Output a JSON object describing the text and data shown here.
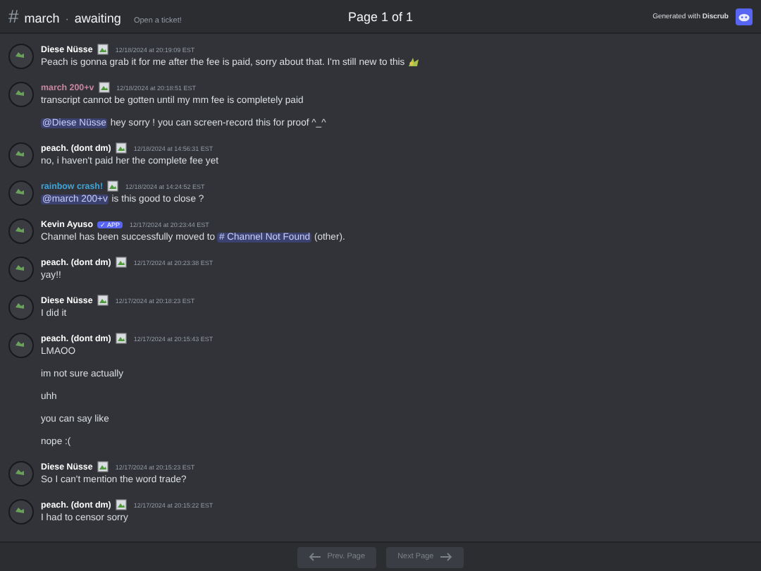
{
  "header": {
    "hash": "#",
    "channel": "march",
    "separator": "·",
    "subchannel": "awaiting",
    "topic": "Open a ticket!",
    "page": "Page 1 of 1",
    "generated_prefix": "Generated with",
    "generated_brand": "Discrub"
  },
  "messages": [
    {
      "author": "Diese Nüsse",
      "color": "#ffffff",
      "kind": "image",
      "timestamp": "12/18/2024 at 20:19:09 EST",
      "lines": [
        [
          {
            "kind": "text",
            "text": "Peach is gonna grab it for me after the fee is paid, sorry about that. I'm still new to this"
          },
          {
            "kind": "emoji"
          }
        ]
      ]
    },
    {
      "author": "march 200+v",
      "color": "#c9869f",
      "kind": "image",
      "timestamp": "12/18/2024 at 20:18:51 EST",
      "lines": [
        [
          {
            "kind": "text",
            "text": "transcript cannot be gotten until my mm fee is completely paid"
          }
        ],
        [
          {
            "kind": "mention",
            "text": "@Diese Nüsse"
          },
          {
            "kind": "text",
            "text": " hey sorry ! you can screen-record this for proof ^_^"
          }
        ]
      ]
    },
    {
      "author": "peach. (dont dm)",
      "color": "#ffffff",
      "kind": "image",
      "timestamp": "12/18/2024 at 14:56:31 EST",
      "lines": [
        [
          {
            "kind": "text",
            "text": "no, i haven't paid her the complete fee yet"
          }
        ]
      ]
    },
    {
      "author": "rainbow crash!",
      "color": "#3fa5d8",
      "kind": "image",
      "timestamp": "12/18/2024 at 14:24:52 EST",
      "lines": [
        [
          {
            "kind": "mention",
            "text": "@march 200+v"
          },
          {
            "kind": "text",
            "text": " is this good to close ?"
          }
        ]
      ]
    },
    {
      "author": "Kevin Ayuso",
      "color": "#ffffff",
      "kind": "app",
      "badge_text": "✓ APP",
      "timestamp": "12/17/2024 at 20:23:44 EST",
      "lines": [
        [
          {
            "kind": "text",
            "text": "Channel has been successfully moved to "
          },
          {
            "kind": "mention",
            "text": "# Channel Not Found"
          },
          {
            "kind": "text",
            "text": " (other)."
          }
        ]
      ]
    },
    {
      "author": "peach. (dont dm)",
      "color": "#ffffff",
      "kind": "image",
      "timestamp": "12/17/2024 at 20:23:38 EST",
      "lines": [
        [
          {
            "kind": "text",
            "text": "yay!!"
          }
        ]
      ]
    },
    {
      "author": "Diese Nüsse",
      "color": "#ffffff",
      "kind": "image",
      "timestamp": "12/17/2024 at 20:18:23 EST",
      "lines": [
        [
          {
            "kind": "text",
            "text": "I did it"
          }
        ]
      ]
    },
    {
      "author": "peach. (dont dm)",
      "color": "#ffffff",
      "kind": "image",
      "timestamp": "12/17/2024 at 20:15:43 EST",
      "lines": [
        [
          {
            "kind": "text",
            "text": "LMAOO"
          }
        ],
        [
          {
            "kind": "text",
            "text": "im not sure actually"
          }
        ],
        [
          {
            "kind": "text",
            "text": "uhh"
          }
        ],
        [
          {
            "kind": "text",
            "text": "you can say like"
          }
        ],
        [
          {
            "kind": "text",
            "text": "nope :("
          }
        ]
      ]
    },
    {
      "author": "Diese Nüsse",
      "color": "#ffffff",
      "kind": "image",
      "timestamp": "12/17/2024 at 20:15:23 EST",
      "lines": [
        [
          {
            "kind": "text",
            "text": "So I can't mention the word trade?"
          }
        ]
      ]
    },
    {
      "author": "peach. (dont dm)",
      "color": "#ffffff",
      "kind": "image",
      "timestamp": "12/17/2024 at 20:15:22 EST",
      "lines": [
        [
          {
            "kind": "text",
            "text": "I had to censor sorry"
          }
        ]
      ]
    }
  ],
  "pager": {
    "prev": "Prev. Page",
    "next": "Next Page",
    "prev_disabled": true,
    "next_disabled": true
  }
}
